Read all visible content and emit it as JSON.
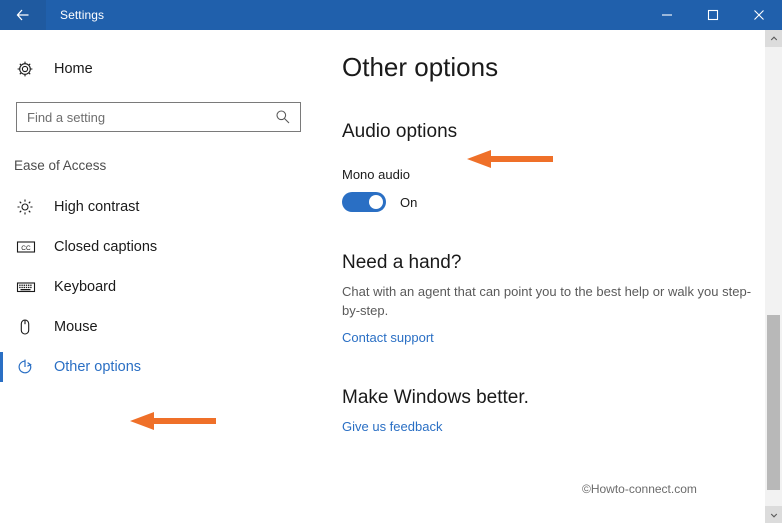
{
  "window": {
    "title": "Settings",
    "back_icon": "back-arrow-icon",
    "controls": [
      {
        "name": "minimize-button",
        "icon": "minimize-icon"
      },
      {
        "name": "maximize-button",
        "icon": "maximize-icon"
      },
      {
        "name": "close-button",
        "icon": "close-icon"
      }
    ],
    "accent_color": "#2060ac"
  },
  "sidebar": {
    "home": {
      "label": "Home",
      "icon": "gear-icon"
    },
    "search": {
      "placeholder": "Find a setting",
      "value": "",
      "icon": "search-icon"
    },
    "section_header": "Ease of Access",
    "items": [
      {
        "label": "High contrast",
        "icon": "brightness-icon",
        "selected": false
      },
      {
        "label": "Closed captions",
        "icon": "closed-captions-icon",
        "selected": false
      },
      {
        "label": "Keyboard",
        "icon": "keyboard-icon",
        "selected": false
      },
      {
        "label": "Mouse",
        "icon": "mouse-icon",
        "selected": false
      },
      {
        "label": "Other options",
        "icon": "other-options-icon",
        "selected": true
      }
    ],
    "selected_color": "#2a6fc4"
  },
  "main": {
    "page_title": "Other options",
    "audio": {
      "group_title": "Audio options",
      "field_label": "Mono audio",
      "toggle_state": "On",
      "toggle_on": true,
      "toggle_color": "#2a6fc4"
    },
    "help": {
      "title": "Need a hand?",
      "description": "Chat with an agent that can point you to the best help or walk you step-by-step.",
      "link": "Contact support"
    },
    "feedback": {
      "title": "Make Windows better.",
      "link": "Give us feedback"
    },
    "watermark": "©Howto-connect.com"
  },
  "annotations": {
    "color": "#ef7029",
    "audio_arrow": "left-arrow-annotation",
    "sidebar_arrow": "left-arrow-annotation"
  },
  "scrollbar": {
    "up_icon": "chevron-up-icon",
    "down_icon": "chevron-down-icon"
  }
}
